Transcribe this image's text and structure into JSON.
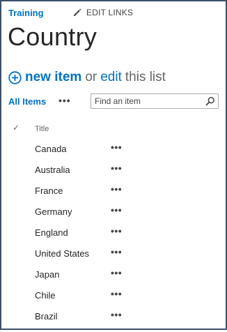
{
  "header": {
    "site_link": "Training",
    "edit_links": "EDIT LINKS"
  },
  "page": {
    "title": "Country"
  },
  "actions": {
    "new_item": "new item",
    "or": "or",
    "edit": "edit",
    "this_list": "this list"
  },
  "view": {
    "all_items": "All Items",
    "ellipsis": "•••"
  },
  "search": {
    "placeholder": "Find an item"
  },
  "list": {
    "check_symbol": "✓",
    "column_title": "Title",
    "row_menu": "•••",
    "items": [
      "Canada",
      "Australia",
      "France",
      "Germany",
      "England",
      "United States",
      "Japan",
      "Chile",
      "Brazil"
    ]
  },
  "colors": {
    "accent": "#0072c6",
    "frame_border": "#3b4f6b",
    "text": "#262626",
    "muted": "#666666"
  },
  "icons": [
    "pencil-icon",
    "plus-circle-icon",
    "search-icon",
    "checkmark-icon",
    "ellipsis-icon"
  ]
}
